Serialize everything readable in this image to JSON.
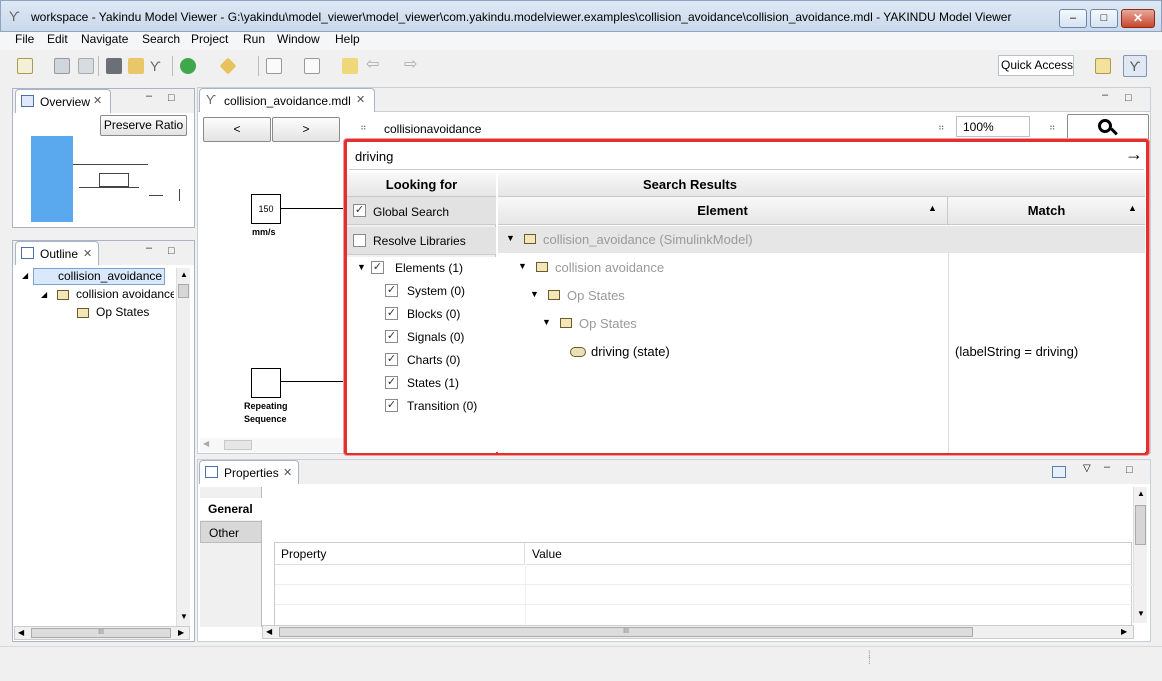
{
  "window": {
    "title": "workspace - Yakindu Model Viewer - G:\\yakindu\\model_viewer\\model_viewer\\com.yakindu.modelviewer.examples\\collision_avoidance\\collision_avoidance.mdl - YAKINDU Model Viewer",
    "minimize": "–",
    "maximize": "□",
    "close": "✕"
  },
  "menu": [
    "File",
    "Edit",
    "Navigate",
    "Search",
    "Project",
    "Run",
    "Window",
    "Help"
  ],
  "toolbar": {
    "quick_access": "Quick Access"
  },
  "overview": {
    "tab": "Overview",
    "preserve_ratio": "Preserve Ratio"
  },
  "outline": {
    "tab": "Outline",
    "items": [
      "collision_avoidance",
      "collision avoidance",
      "Op States"
    ]
  },
  "editor": {
    "tab": "collision_avoidance.mdl",
    "back": "<",
    "forward": ">",
    "breadcrumb": "collisionavoidance",
    "zoom": "100%",
    "block_value": "150",
    "block_unit": "mm/s",
    "block2_label_1": "Repeating",
    "block2_label_2": "Sequence"
  },
  "search": {
    "query": "driving",
    "looking_for_header": "Looking for",
    "results_header": "Search Results",
    "global_search": "Global Search",
    "global_search_checked": true,
    "resolve_libraries": "Resolve Libraries",
    "resolve_libraries_checked": false,
    "filters": [
      {
        "label": "Elements (1)",
        "checked": true
      },
      {
        "label": "System (0)",
        "checked": true
      },
      {
        "label": "Blocks (0)",
        "checked": true
      },
      {
        "label": "Signals (0)",
        "checked": true
      },
      {
        "label": "Charts (0)",
        "checked": true
      },
      {
        "label": "States (1)",
        "checked": true
      },
      {
        "label": "Transition (0)",
        "checked": true
      }
    ],
    "col_element": "Element",
    "col_match": "Match",
    "results": [
      {
        "label": "collision_avoidance (SimulinkModel)",
        "match": ""
      },
      {
        "label": "collision avoidance",
        "match": ""
      },
      {
        "label": "Op States",
        "match": ""
      },
      {
        "label": "Op States",
        "match": ""
      },
      {
        "label": "driving (state)",
        "match": "(labelString = driving)"
      }
    ]
  },
  "properties": {
    "tab": "Properties",
    "tabs": [
      "General",
      "Other"
    ],
    "col_property": "Property",
    "col_value": "Value"
  },
  "scrollbar_grip": "III"
}
